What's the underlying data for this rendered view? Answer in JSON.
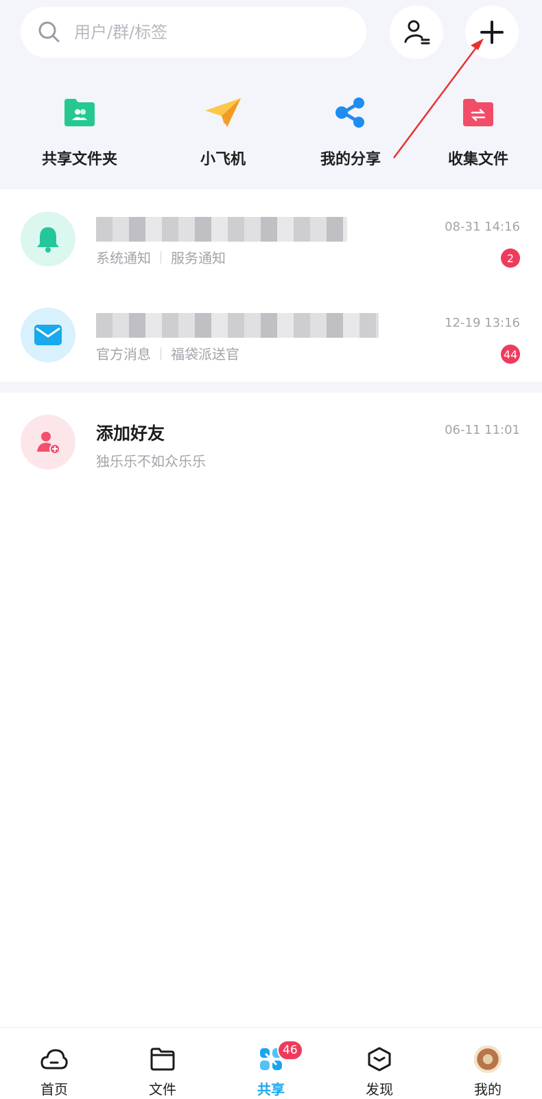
{
  "search": {
    "placeholder": "用户/群/标签"
  },
  "quick_actions": [
    {
      "label": "共享文件夹",
      "icon": "shared-folder-icon",
      "color": "#25c990"
    },
    {
      "label": "小飞机",
      "icon": "paper-plane-icon",
      "color": "#f5a623"
    },
    {
      "label": "我的分享",
      "icon": "share-icon",
      "color": "#1f8cf0"
    },
    {
      "label": "收集文件",
      "icon": "collect-folder-icon",
      "color": "#f24d68"
    }
  ],
  "messages": [
    {
      "title": "",
      "sub1": "系统通知",
      "sub2": "服务通知",
      "time": "08-31 14:16",
      "badge": "2",
      "icon": "bell-icon",
      "bg": "#dcf7ef",
      "color": "#24c79a"
    },
    {
      "title": "",
      "sub1": "官方消息",
      "sub2": "福袋派送官",
      "time": "12-19 13:16",
      "badge": "44",
      "icon": "mail-icon",
      "bg": "#d9f1fc",
      "color": "#19a9ec"
    },
    {
      "title": "添加好友",
      "sub": "独乐乐不如众乐乐",
      "time": "06-11 11:01",
      "icon": "add-friend-icon",
      "bg": "#fde6ea",
      "color": "#f3506d"
    }
  ],
  "bottom_nav": [
    {
      "label": "首页",
      "icon": "cloud-icon"
    },
    {
      "label": "文件",
      "icon": "folder-icon"
    },
    {
      "label": "共享",
      "icon": "share-x-icon",
      "badge": "46",
      "active": true
    },
    {
      "label": "发现",
      "icon": "discover-box-icon"
    },
    {
      "label": "我的",
      "icon": "user-avatar"
    }
  ],
  "colors": {
    "accent": "#1aa6ee",
    "badge": "#ee3b5c",
    "annotation": "#e8322f"
  }
}
